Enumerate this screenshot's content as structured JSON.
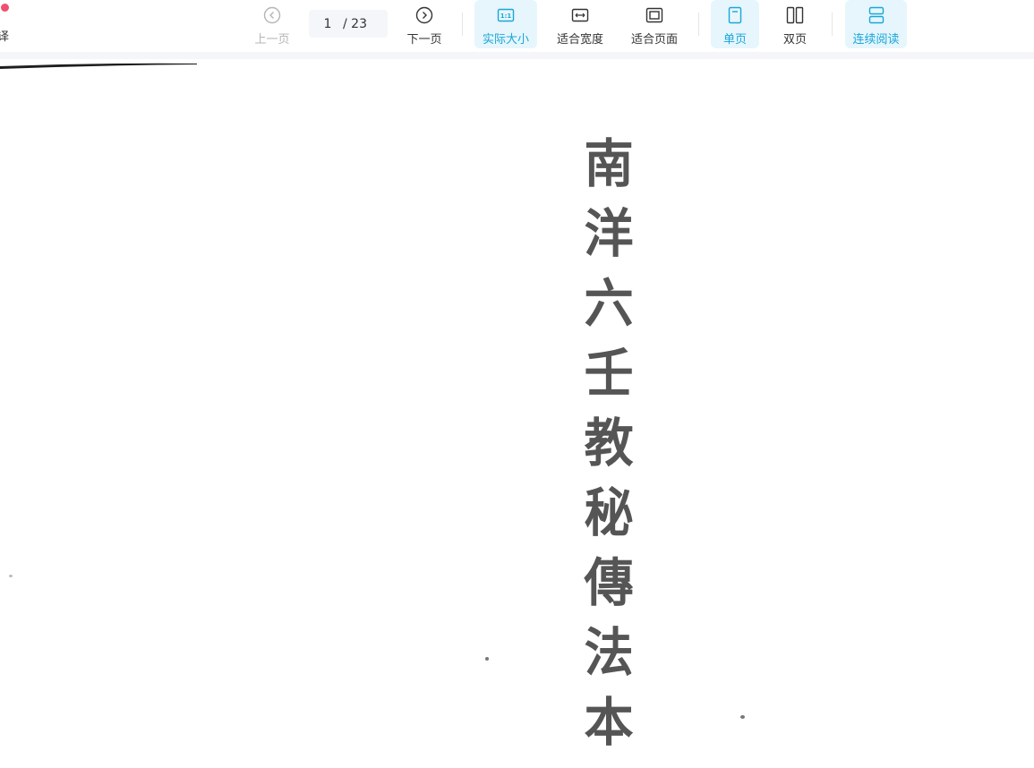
{
  "toolbar": {
    "left_cut_text": "译",
    "prev_label": "上一页",
    "current_page": "1",
    "total_pages": "/ 23",
    "next_label": "下一页",
    "actual_size_label": "实际大小",
    "actual_size_icon_text": "1:1",
    "fit_width_label": "适合宽度",
    "fit_page_label": "适合页面",
    "single_page_label": "单页",
    "double_page_label": "双页",
    "continuous_label": "连续阅读"
  },
  "document": {
    "title_chars": [
      "南",
      "洋",
      "六",
      "壬",
      "教",
      "秘",
      "傳",
      "法",
      "本"
    ]
  },
  "colors": {
    "accent": "#1aa6d8",
    "active_bg": "#e6f6fc",
    "record_dot": "#f0506e"
  }
}
